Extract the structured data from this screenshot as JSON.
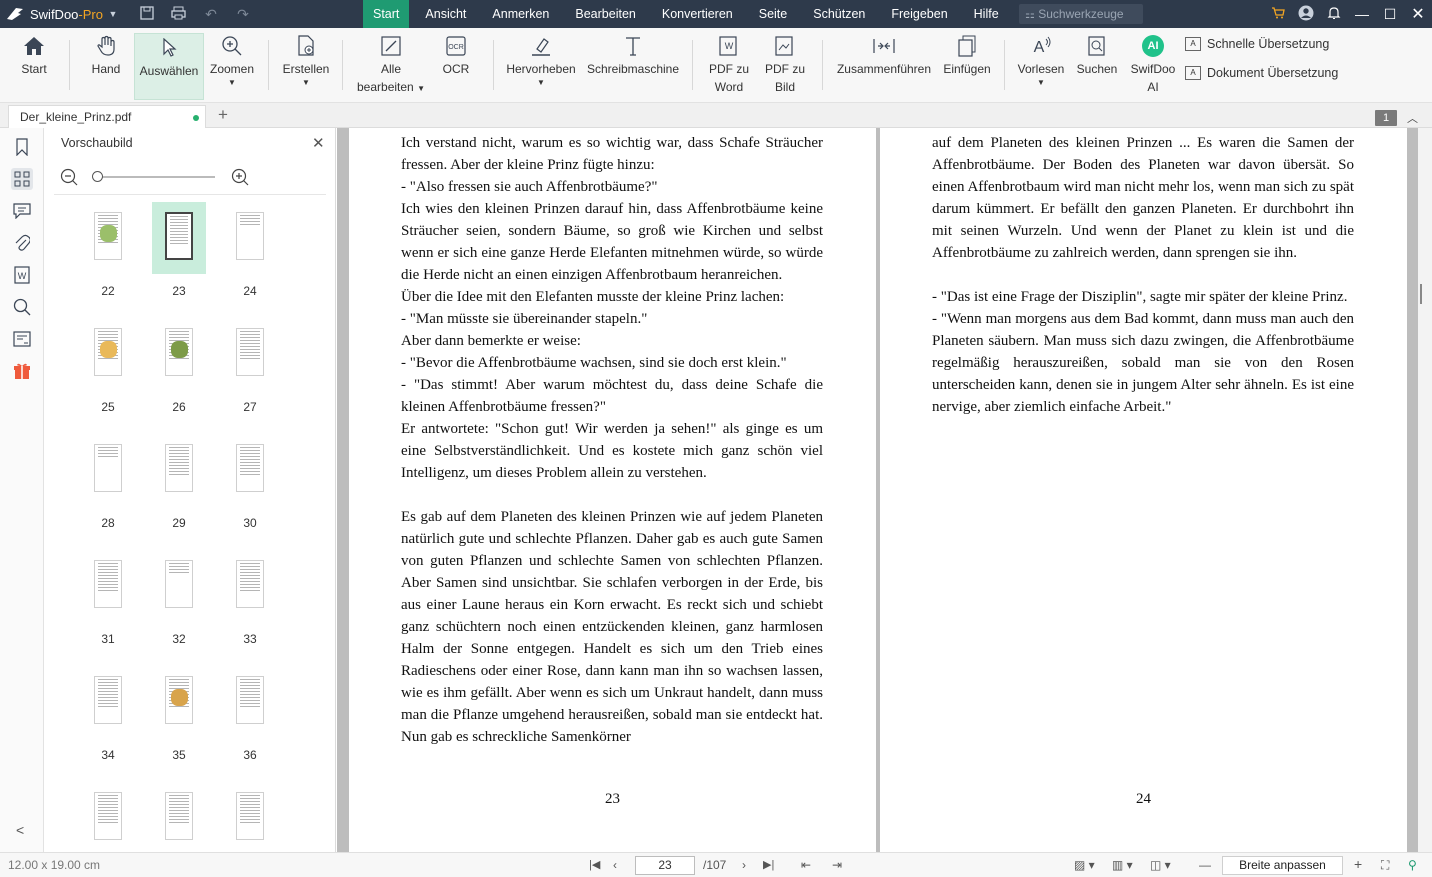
{
  "app": {
    "name": "SwifDoo",
    "edition": "-Pro"
  },
  "menu": [
    "Start",
    "Ansicht",
    "Anmerken",
    "Bearbeiten",
    "Konvertieren",
    "Seite",
    "Schützen",
    "Freigeben",
    "Hilfe"
  ],
  "menu_active": "Start",
  "search_tools_placeholder": "Suchwerkzeuge",
  "ribbon": {
    "start": "Start",
    "hand": "Hand",
    "select": "Auswählen",
    "zoom": "Zoomen",
    "create": "Erstellen",
    "edit_all_1": "Alle",
    "edit_all_2": "bearbeiten",
    "ocr": "OCR",
    "highlight": "Hervorheben",
    "typewriter": "Schreibmaschine",
    "pdf_word_1": "PDF zu",
    "pdf_word_2": "Word",
    "pdf_image_1": "PDF zu",
    "pdf_image_2": "Bild",
    "merge": "Zusammenführen",
    "insert": "Einfügen",
    "read_aloud": "Vorlesen",
    "search": "Suchen",
    "ai_1": "SwifDoo",
    "ai_2": "AI",
    "ai_badge": "AI",
    "quick_translate": "Schnelle Übersetzung",
    "doc_translate": "Dokument Übersetzung"
  },
  "tab": {
    "filename": "Der_kleine_Prinz.pdf"
  },
  "page_badge": "1",
  "thumb_panel": {
    "title": "Vorschaubild",
    "pages": [
      "22",
      "23",
      "24",
      "25",
      "26",
      "27",
      "28",
      "29",
      "30",
      "31",
      "32",
      "33",
      "34",
      "35",
      "36",
      "",
      "",
      ""
    ],
    "selected": "23"
  },
  "page_left": {
    "lines": [
      "Ich verstand nicht, warum es so wichtig war, dass Schafe Sträucher fressen. Aber der kleine Prinz fügte hinzu:",
      "-  \"Also fressen sie auch Affenbrotbäume?\"",
      "Ich wies den kleinen Prinzen darauf hin, dass Affenbrotbäume keine Sträucher seien, sondern Bäume, so groß wie Kirchen und selbst wenn er sich eine ganze Herde Elefanten mitnehmen würde, so würde die Herde nicht an einen einzigen Affenbrotbaum heranreichen.",
      "Über die Idee mit den Elefanten musste der kleine Prinz lachen:",
      "- \"Man müsste sie übereinander stapeln.\"",
      "Aber dann bemerkte er weise:",
      "- \"Bevor die Affenbrotbäume wachsen, sind sie doch erst klein.\"",
      "- \"Das stimmt! Aber warum möchtest du, dass deine Schafe die kleinen Affenbrotbäume fressen?\"",
      "Er antwortete: \"Schon gut! Wir werden ja sehen!\" als ginge es um eine Selbstverständlichkeit. Und es kostete mich ganz schön viel Intelligenz, um dieses Problem allein zu verstehen.",
      "",
      "Es gab auf dem Planeten des kleinen Prinzen wie auf jedem Planeten natürlich gute und schlechte Pflanzen. Daher gab es auch gute Samen von guten Pflanzen und schlechte Samen von schlechten Pflanzen. Aber Samen sind unsichtbar. Sie schlafen verborgen in der Erde, bis aus einer Laune heraus ein Korn erwacht. Es reckt sich und schiebt ganz schüchtern noch einen entzückenden kleinen, ganz harmlosen Halm der Sonne entgegen. Handelt es sich um den Trieb eines Radieschens oder einer Rose, dann kann man ihn so wachsen lassen, wie es ihm gefällt. Aber wenn es sich um Unkraut handelt, dann muss man die Pflanze umgehend herausreißen, sobald man sie entdeckt hat. Nun gab es schreckliche Samenkörner"
    ],
    "number": "23"
  },
  "page_right": {
    "lines": [
      "auf dem Planeten des kleinen Prinzen ... Es waren die Samen der Affenbrotbäume. Der Boden des Planeten war davon übersät. So einen Affenbrotbaum wird man nicht mehr los, wenn man sich zu spät darum kümmert. Er befällt den ganzen Planeten. Er durchbohrt ihn mit seinen Wurzeln. Und wenn der Planet zu klein ist und die Affenbrotbäume zu zahlreich werden, dann sprengen sie ihn.",
      "",
      "- \"Das ist eine Frage der Disziplin\", sagte mir später der kleine Prinz.",
      "- \"Wenn man morgens aus dem Bad kommt, dann muss man auch den Planeten säubern. Man muss sich dazu zwingen, die Affenbrotbäume regelmäßig herauszureißen, sobald man sie von den Rosen unterscheiden kann, denen sie in jungem Alter sehr ähneln. Es ist eine nervige, aber ziemlich einfache Arbeit.\""
    ],
    "number": "24"
  },
  "status": {
    "page_size": "12.00 x 19.00 cm",
    "current_page": "23",
    "total_pages": "/107",
    "fit": "Breite anpassen"
  },
  "colors": {
    "titlebar": "#2e3a4b",
    "accent": "#1f9b72",
    "ai": "#20c28a"
  }
}
